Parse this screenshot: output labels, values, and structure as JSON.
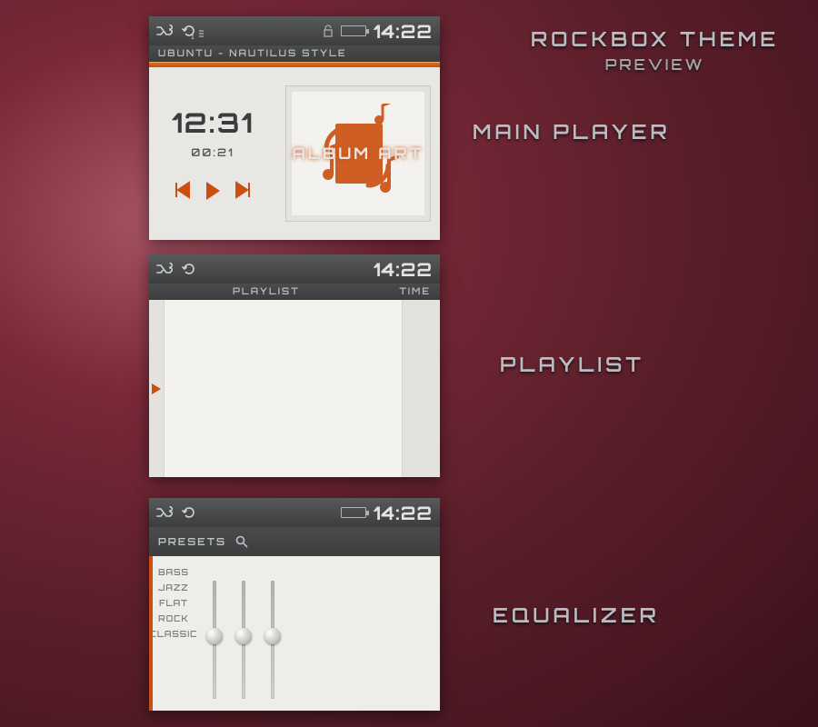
{
  "title": "ROCKBOX THEME",
  "subtitle": "PREVIEW",
  "labels": {
    "main_player": "MAIN PLAYER",
    "playlist": "PLAYLIST",
    "equalizer": "EQUALIZER"
  },
  "colors": {
    "accent": "#cc4e10",
    "bar": "#3c3d3e"
  },
  "main_player": {
    "clock": "14:22",
    "subtitle": "UBUNTU - NAUTILUS STYLE",
    "track_time": "12:31",
    "elapsed": "00:21",
    "album_art_label": "ALBUM ART",
    "repeat_badge": "1"
  },
  "playlist": {
    "clock": "14:22",
    "header_left": "PLAYLIST",
    "header_right": "TIME"
  },
  "equalizer": {
    "clock": "14:22",
    "presets_label": "PRESETS",
    "presets": [
      "BASS",
      "JAZZ",
      "FLAT",
      "ROCK",
      "CLASSIC"
    ],
    "sliders": [
      50,
      50,
      50
    ]
  }
}
